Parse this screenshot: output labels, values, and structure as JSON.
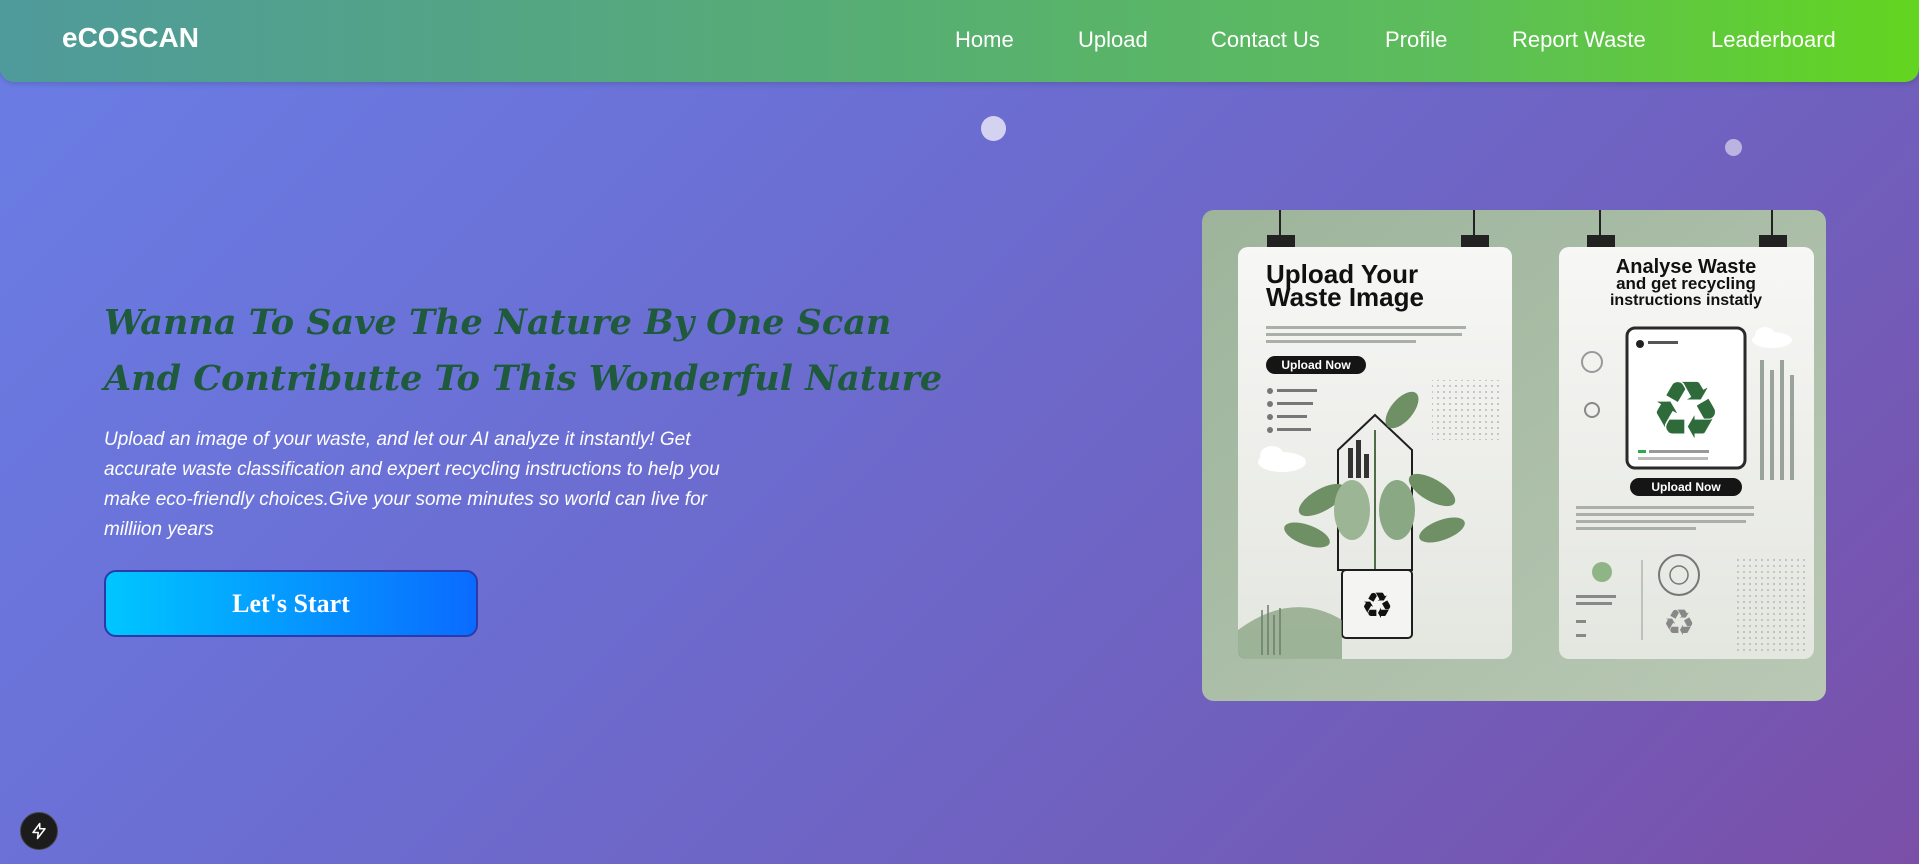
{
  "header": {
    "brand": "eCOSCAN",
    "nav": [
      {
        "label": "Home"
      },
      {
        "label": "Upload"
      },
      {
        "label": "Contact Us"
      },
      {
        "label": "Profile"
      },
      {
        "label": "Report Waste"
      },
      {
        "label": "Leaderboard"
      }
    ]
  },
  "hero": {
    "headline_line1": "Wanna To Save The Nature By One Scan",
    "headline_line2": "And Contributte To This Wonderful Nature",
    "description": "Upload an image of your waste, and let our AI analyze it instantly! Get accurate waste classification and expert recycling instructions to help you make eco-friendly choices.Give your some minutes so world can live for milliion years",
    "cta_label": "Let's Start"
  },
  "illustration": {
    "left_card": {
      "title_line1": "Upload Your",
      "title_line2": "Waste Image",
      "button": "Upload Now"
    },
    "right_card": {
      "title_line1": "Analyse Waste",
      "title_line2": "and get recycling",
      "title_line3": "instructions instatly",
      "button": "Upload Now"
    }
  },
  "floating_action": {
    "icon": "lightning-bolt-icon"
  },
  "colors": {
    "headline": "#1f5a3c",
    "cta_start": "#00c6ff",
    "cta_end": "#0a6bff",
    "nav_start": "#4f9a9b",
    "nav_end": "#63d520"
  }
}
